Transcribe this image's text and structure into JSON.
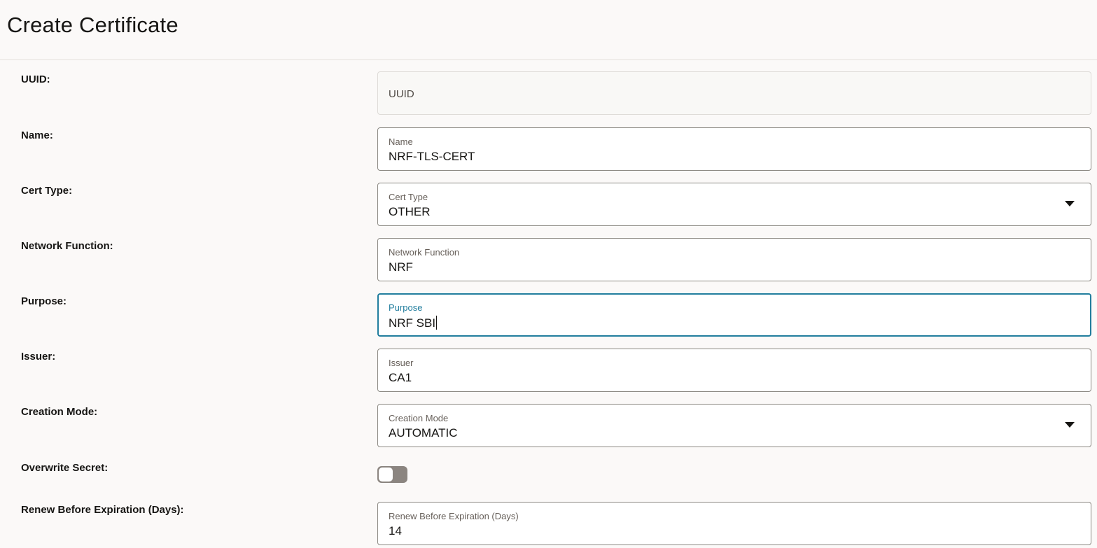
{
  "header": {
    "title": "Create Certificate"
  },
  "form": {
    "uuid": {
      "label": "UUID:",
      "placeholder": "UUID"
    },
    "name": {
      "label": "Name:",
      "field_label": "Name",
      "value": "NRF-TLS-CERT"
    },
    "cert_type": {
      "label": "Cert Type:",
      "field_label": "Cert Type",
      "value": "OTHER",
      "icon": "chevron-down-icon"
    },
    "network_function": {
      "label": "Network Function:",
      "field_label": "Network Function",
      "value": "NRF"
    },
    "purpose": {
      "label": "Purpose:",
      "field_label": "Purpose",
      "value": "NRF SBI"
    },
    "issuer": {
      "label": "Issuer:",
      "field_label": "Issuer",
      "value": "CA1"
    },
    "creation_mode": {
      "label": "Creation Mode:",
      "field_label": "Creation Mode",
      "value": "AUTOMATIC",
      "icon": "chevron-down-icon"
    },
    "overwrite_secret": {
      "label": "Overwrite Secret:",
      "checked": false
    },
    "renew_before": {
      "label": "Renew Before Expiration (Days):",
      "field_label": "Renew Before Expiration (Days)",
      "value": "14"
    }
  },
  "colors": {
    "focus": "#227e9e",
    "toggle_off": "#8b8580",
    "page_bg": "#fbf9f8"
  }
}
